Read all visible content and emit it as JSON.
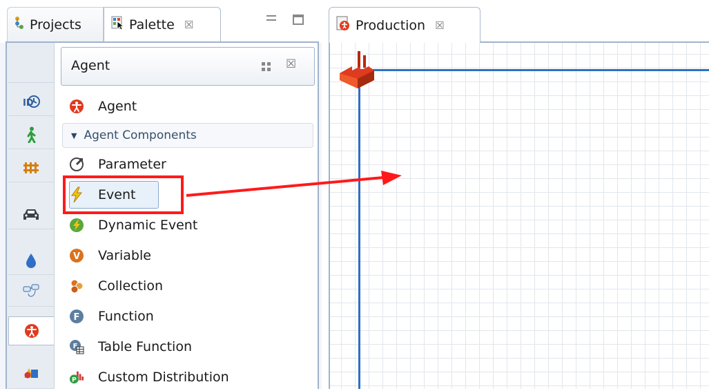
{
  "left_view": {
    "tabs": [
      {
        "label": "Projects",
        "icon": "projects-icon"
      },
      {
        "label": "Palette",
        "icon": "palette-icon",
        "close": "☒"
      }
    ],
    "categories": [
      {
        "name": "blank-category",
        "icon": ""
      },
      {
        "name": "process-modeling",
        "icon": "process-icon"
      },
      {
        "name": "pedestrian",
        "icon": "pedestrian-icon"
      },
      {
        "name": "rail",
        "icon": "rail-icon"
      },
      {
        "name": "road-traffic",
        "icon": "car-icon"
      },
      {
        "name": "fluid",
        "icon": "drop-icon"
      },
      {
        "name": "statechart",
        "icon": "statechart-icon"
      },
      {
        "name": "agent",
        "icon": "agent-icon",
        "selected": true
      },
      {
        "name": "presentation",
        "icon": "shapes-icon"
      }
    ],
    "section": {
      "title": "Agent",
      "close": "☒"
    },
    "items": [
      {
        "label": "Agent",
        "icon": "agent-icon"
      },
      {
        "label": "Parameter",
        "icon": "parameter-icon"
      },
      {
        "label": "Event",
        "icon": "event-icon"
      },
      {
        "label": "Dynamic Event",
        "icon": "dynamic-event-icon"
      },
      {
        "label": "Variable",
        "icon": "variable-icon"
      },
      {
        "label": "Collection",
        "icon": "collection-icon"
      },
      {
        "label": "Function",
        "icon": "function-icon"
      },
      {
        "label": "Table Function",
        "icon": "table-function-icon"
      },
      {
        "label": "Custom Distribution",
        "icon": "custom-distribution-icon"
      }
    ],
    "group": {
      "label": "Agent Components"
    }
  },
  "right_view": {
    "tab": {
      "label": "Production",
      "icon": "agent-type-icon",
      "close": "☒"
    }
  },
  "annotation": {
    "highlight_color": "#ff1a1a",
    "target": "Event"
  },
  "colors": {
    "axis": "#2f6fc4",
    "agent_red": "#e03a1f",
    "frame": "#9fb3cb"
  }
}
